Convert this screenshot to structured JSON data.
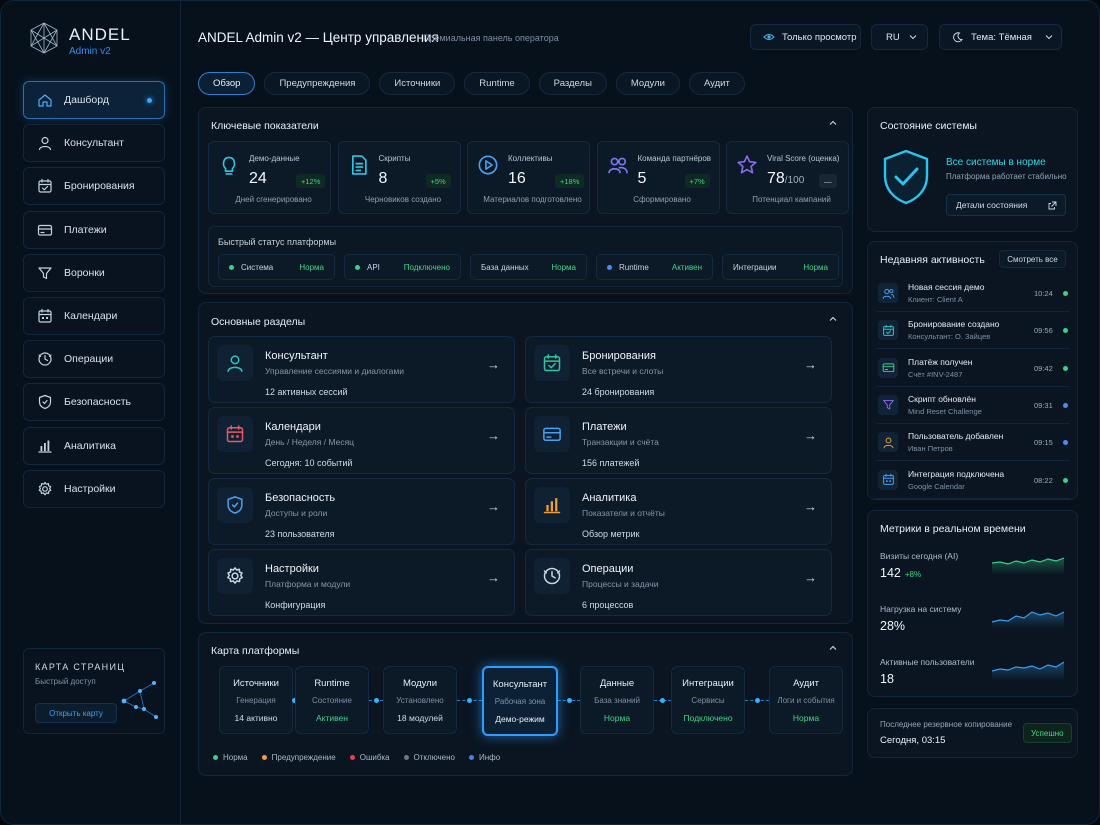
{
  "app": {
    "logo_title": "ANDEL",
    "logo_sub": "Admin v2",
    "title": "ANDEL Admin v2 — Центр управления",
    "subtitle": "Премиальная панель оператора"
  },
  "top": {
    "readonly": "Только просмотр",
    "lang": "RU",
    "theme": "Тема: Тёмная"
  },
  "sidebar": {
    "items": [
      {
        "label": "Дашборд",
        "icon": "home-icon"
      },
      {
        "label": "Консультант",
        "icon": "user-icon"
      },
      {
        "label": "Бронирования",
        "icon": "calendar-check-icon"
      },
      {
        "label": "Платежи",
        "icon": "card-icon"
      },
      {
        "label": "Воронки",
        "icon": "funnel-icon"
      },
      {
        "label": "Календари",
        "icon": "calendar-icon"
      },
      {
        "label": "Операции",
        "icon": "clock-icon"
      },
      {
        "label": "Безопасность",
        "icon": "shield-icon"
      },
      {
        "label": "Аналитика",
        "icon": "chart-icon"
      },
      {
        "label": "Настройки",
        "icon": "gear-icon"
      }
    ],
    "map": {
      "title": "КАРТА СТРАНИЦ",
      "subtitle": "Быстрый доступ",
      "button": "Открыть карту"
    }
  },
  "tabs": [
    "Обзор",
    "Предупреждения",
    "Источники",
    "Runtime",
    "Разделы",
    "Модули",
    "Аудит"
  ],
  "kpi": {
    "title": "Ключевые показатели",
    "cards": [
      {
        "name": "Демо-данные",
        "value": "24",
        "unit": "",
        "badge": "+12%",
        "note": "Дней сгенерировано",
        "icon": "bulb-icon"
      },
      {
        "name": "Скрипты",
        "value": "8",
        "unit": "",
        "badge": "+5%",
        "note": "Черновиков создано",
        "icon": "document-icon"
      },
      {
        "name": "Коллективы",
        "value": "16",
        "unit": "",
        "badge": "+18%",
        "note": "Материалов подготовлено",
        "icon": "play-icon"
      },
      {
        "name": "Команда партнёров",
        "value": "5",
        "unit": "",
        "badge": "+7%",
        "note": "Сформировано",
        "icon": "team-icon"
      },
      {
        "name": "Viral Score (оценка)",
        "value": "78",
        "unit": "/100",
        "badge": "—",
        "note": "Потенциал кампаний",
        "icon": "star-icon"
      }
    ],
    "status_title": "Быстрый статус платформы",
    "status": [
      {
        "name": "Система",
        "value": "Норма",
        "dot": "#3ad08a"
      },
      {
        "name": "API",
        "value": "Подключено",
        "dot": "#3ad08a"
      },
      {
        "name": "База данных",
        "value": "Норма",
        "dot": ""
      },
      {
        "name": "Runtime",
        "value": "Активен",
        "dot": "#4b8cf0"
      },
      {
        "name": "Интеграции",
        "value": "Норма",
        "dot": ""
      }
    ]
  },
  "sections": {
    "title": "Основные разделы",
    "items": [
      {
        "title": "Консультант",
        "sub": "Управление сессиями и диалогами",
        "count": "12 активных сессий",
        "icon": "user-icon",
        "color": "#2fc6c6"
      },
      {
        "title": "Бронирования",
        "sub": "Все встречи и слоты",
        "count": "24 бронирования",
        "icon": "calendar-check-icon",
        "color": "#2fc6a0"
      },
      {
        "title": "Календари",
        "sub": "День / Неделя / Месяц",
        "count": "Сегодня: 10 событий",
        "icon": "calendar-icon",
        "color": "#e55a6a"
      },
      {
        "title": "Платежи",
        "sub": "Транзакции и счёта",
        "count": "156 платежей",
        "icon": "card-icon",
        "color": "#4ba0f0"
      },
      {
        "title": "Безопасность",
        "sub": "Доступы и роли",
        "count": "23 пользователя",
        "icon": "shield-icon",
        "color": "#4ba0f0"
      },
      {
        "title": "Аналитика",
        "sub": "Показатели и отчёты",
        "count": "Обзор метрик",
        "icon": "chart-icon",
        "color": "#f0a030"
      },
      {
        "title": "Настройки",
        "sub": "Платформа и модули",
        "count": "Конфигурация",
        "icon": "gear-icon",
        "color": "#c8d4e0"
      },
      {
        "title": "Операции",
        "sub": "Процессы и задачи",
        "count": "6 процессов",
        "icon": "clock-icon",
        "color": "#c8d4e0"
      }
    ]
  },
  "platform_map": {
    "title": "Карта платформы",
    "nodes": [
      {
        "title": "Источники",
        "sub": "Генерация",
        "status": "14 активно",
        "ok": false
      },
      {
        "title": "Runtime",
        "sub": "Состояние",
        "status": "Активен",
        "ok": true
      },
      {
        "title": "Модули",
        "sub": "Установлено",
        "status": "18 модулей",
        "ok": false
      },
      {
        "title": "Консультант",
        "sub": "Рабочая зона",
        "status": "Демо-режим",
        "ok": false
      },
      {
        "title": "Данные",
        "sub": "База знаний",
        "status": "Норма",
        "ok": true
      },
      {
        "title": "Интеграции",
        "sub": "Сервисы",
        "status": "Подключено",
        "ok": true
      },
      {
        "title": "Аудит",
        "sub": "Логи и события",
        "status": "Норма",
        "ok": true
      }
    ],
    "legend": [
      {
        "label": "Норма",
        "color": "#3ad08a"
      },
      {
        "label": "Предупреждение",
        "color": "#f0a030"
      },
      {
        "label": "Ошибка",
        "color": "#e5404a"
      },
      {
        "label": "Отключено",
        "color": "#6a7686"
      },
      {
        "label": "Инфо",
        "color": "#4b7cf0"
      }
    ]
  },
  "system": {
    "title": "Состояние системы",
    "ok": "Все системы в норме",
    "desc": "Платформа работает стабильно",
    "details": "Детали состояния"
  },
  "activity": {
    "title": "Недавняя активность",
    "view_all": "Смотреть все",
    "items": [
      {
        "title": "Новая сессия демо",
        "sub": "Клиент: Client A",
        "time": "10:24",
        "dot": "#3ad08a",
        "icon": "users-icon",
        "color": "#4ba0f0"
      },
      {
        "title": "Бронирование создано",
        "sub": "Консультант: О. Зайцев",
        "time": "09:56",
        "dot": "#3ad08a",
        "icon": "calendar-check-icon",
        "color": "#2fc6c6"
      },
      {
        "title": "Платёж получен",
        "sub": "Счёт #INV-2487",
        "time": "09:42",
        "dot": "#3ad08a",
        "icon": "card-icon",
        "color": "#3ad08a"
      },
      {
        "title": "Скрипт обновлён",
        "sub": "Mind Reset Challenge",
        "time": "09:31",
        "dot": "#4b8cf0",
        "icon": "funnel-icon",
        "color": "#8a6af0"
      },
      {
        "title": "Пользователь добавлен",
        "sub": "Иван Петров",
        "time": "09:15",
        "dot": "#4b8cf0",
        "icon": "user-icon",
        "color": "#f0a030"
      },
      {
        "title": "Интеграция подключена",
        "sub": "Google Calendar",
        "time": "08:22",
        "dot": "#3ad08a",
        "icon": "calendar-icon",
        "color": "#4ba0f0"
      }
    ]
  },
  "metrics": {
    "title": "Метрики в реальном времени",
    "items": [
      {
        "label": "Визиты сегодня (AI)",
        "value": "142",
        "delta": "+8%",
        "color": "#3ad08a"
      },
      {
        "label": "Нагрузка на систему",
        "value": "28%",
        "delta": "",
        "color": "#3a9ff0"
      },
      {
        "label": "Активные пользователи",
        "value": "18",
        "delta": "",
        "color": "#3a9ff0"
      }
    ]
  },
  "backup": {
    "label": "Последнее резервное копирование",
    "time": "Сегодня, 03:15",
    "status": "Успешно"
  }
}
